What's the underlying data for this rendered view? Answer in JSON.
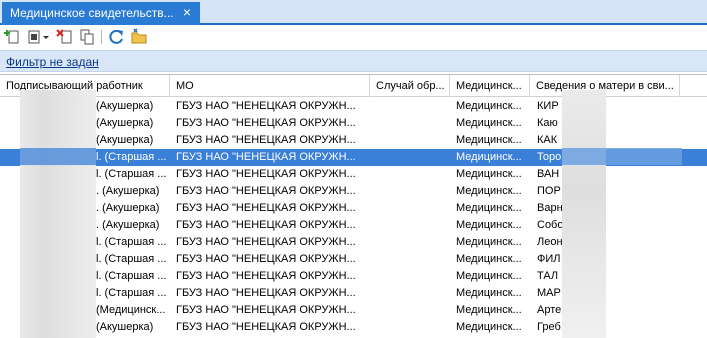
{
  "tab": {
    "title": "Медицинское свидетельств...",
    "close_glyph": "×"
  },
  "toolbar": {
    "buttons": [
      "add-icon",
      "edit-dropdown-icon",
      "delete-icon",
      "copy-icon",
      "refresh-icon",
      "folder-icon"
    ]
  },
  "filter": {
    "label": "Фильтр не задан"
  },
  "grid": {
    "columns": [
      "Подписывающий работник",
      "МО",
      "Случай обр...",
      "Медицинск...",
      "Сведения о матери в сви..."
    ],
    "rows": [
      {
        "worker": "(Акушерка)",
        "mo": "ГБУЗ НАО \"НЕНЕЦКАЯ ОКРУЖН...",
        "medic": "Медицинск...",
        "mother": "КИР",
        "selected": false
      },
      {
        "worker": "(Акушерка)",
        "mo": "ГБУЗ НАО \"НЕНЕЦКАЯ ОКРУЖН...",
        "medic": "Медицинск...",
        "mother": "Каю",
        "selected": false
      },
      {
        "worker": "(Акушерка)",
        "mo": "ГБУЗ НАО \"НЕНЕЦКАЯ ОКРУЖН...",
        "medic": "Медицинск...",
        "mother": "КАК",
        "selected": false
      },
      {
        "worker": "l. (Старшая ...",
        "mo": "ГБУЗ НАО \"НЕНЕЦКАЯ ОКРУЖН...",
        "medic": "Медицинск...",
        "mother": "Торо",
        "selected": true
      },
      {
        "worker": "l. (Старшая ...",
        "mo": "ГБУЗ НАО \"НЕНЕЦКАЯ ОКРУЖН...",
        "medic": "Медицинск...",
        "mother": "ВАН",
        "selected": false
      },
      {
        "worker": ". (Акушерка)",
        "mo": "ГБУЗ НАО \"НЕНЕЦКАЯ ОКРУЖН...",
        "medic": "Медицинск...",
        "mother": "ПОР",
        "selected": false
      },
      {
        "worker": ". (Акушерка)",
        "mo": "ГБУЗ НАО \"НЕНЕЦКАЯ ОКРУЖН...",
        "medic": "Медицинск...",
        "mother": "Варн",
        "selected": false
      },
      {
        "worker": ". (Акушерка)",
        "mo": "ГБУЗ НАО \"НЕНЕЦКАЯ ОКРУЖН...",
        "medic": "Медицинск...",
        "mother": "Собо",
        "selected": false
      },
      {
        "worker": "l. (Старшая ...",
        "mo": "ГБУЗ НАО \"НЕНЕЦКАЯ ОКРУЖН...",
        "medic": "Медицинск...",
        "mother": "Леон",
        "selected": false
      },
      {
        "worker": "l. (Старшая ...",
        "mo": "ГБУЗ НАО \"НЕНЕЦКАЯ ОКРУЖН...",
        "medic": "Медицинск...",
        "mother": "ФИЛ",
        "selected": false
      },
      {
        "worker": "l. (Старшая ...",
        "mo": "ГБУЗ НАО \"НЕНЕЦКАЯ ОКРУЖН...",
        "medic": "Медицинск...",
        "mother": "ТАЛ",
        "selected": false
      },
      {
        "worker": "l. (Старшая ...",
        "mo": "ГБУЗ НАО \"НЕНЕЦКАЯ ОКРУЖН...",
        "medic": "Медицинск...",
        "mother": "МАР",
        "selected": false
      },
      {
        "worker": "(Медицинск...",
        "mo": "ГБУЗ НАО \"НЕНЕЦКАЯ ОКРУЖН...",
        "medic": "Медицинск...",
        "mother": "Арте",
        "selected": false
      },
      {
        "worker": "(Акушерка)",
        "mo": "ГБУЗ НАО \"НЕНЕЦКАЯ ОКРУЖН...",
        "medic": "Медицинск...",
        "mother": "Греб",
        "selected": false
      }
    ]
  },
  "colors": {
    "accent": "#2a7bd4",
    "selection": "#3a7fd8",
    "filter_bg": "#d9e6f5"
  }
}
